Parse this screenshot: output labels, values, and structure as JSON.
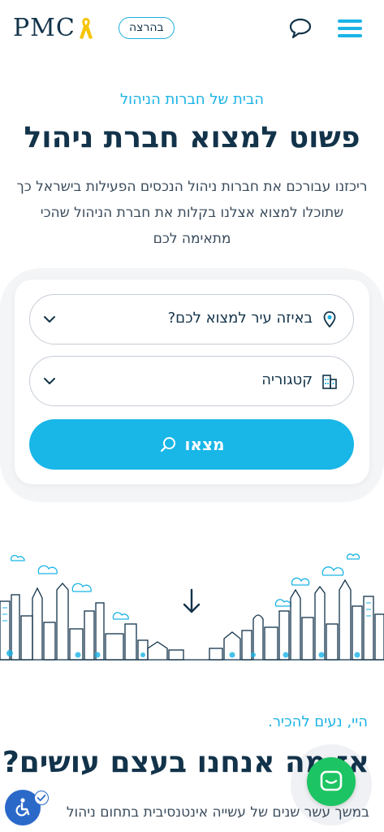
{
  "header": {
    "logo_text": "PMC",
    "badge_label": "בהרצה",
    "icons": {
      "chat": "chat-bubble-icon",
      "menu": "hamburger-menu-icon",
      "ribbon": "yellow-ribbon-icon"
    }
  },
  "hero": {
    "eyebrow": "הבית של חברות הניהול",
    "title_regular": "פשוט למצוא ",
    "title_bold": "חברת ניהול",
    "description": "ריכזנו עבורכם את חברות ניהול הנכסים הפעילות בישראל כך שתוכלו למצוא אצלנו בקלות את חברת הניהול שהכי מתאימה לכם"
  },
  "search": {
    "city_placeholder": "באיזה עיר למצוא לכם?",
    "category_placeholder": "קטגוריה",
    "submit_label": "מצאו"
  },
  "about": {
    "eyebrow": "היי, נעים להכיר.",
    "title_regular": "אז מה אנחנו ",
    "title_bold": "בעצם עושים?",
    "text": "במשך עשר שנים של עשייה אינטנסיבית בתחום ניהול"
  },
  "colors": {
    "accent": "#1ab3e6",
    "navy": "#12334a",
    "chat_green": "#1dc463",
    "a11y_blue": "#2b69c9"
  }
}
